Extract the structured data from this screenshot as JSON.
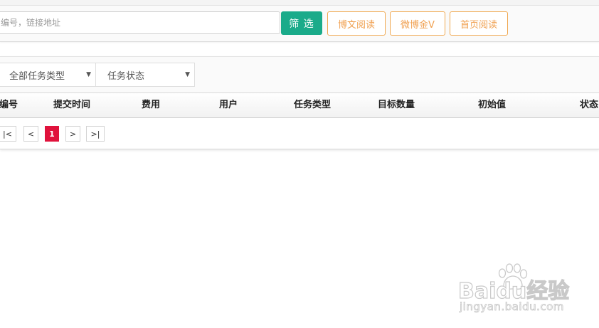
{
  "search": {
    "placeholder": "编号，链接地址",
    "filter_button": "筛 选",
    "quick_links": [
      "博文阅读",
      "微博金V",
      "首页阅读"
    ]
  },
  "filters": {
    "task_type": "全部任务类型",
    "task_status": "任务状态"
  },
  "table": {
    "columns": [
      "编号",
      "提交时间",
      "费用",
      "用户",
      "任务类型",
      "目标数量",
      "初始值",
      "状态"
    ],
    "rows": []
  },
  "pagination": {
    "first": "|<",
    "prev": "<",
    "current_page": "1",
    "next": ">",
    "last": ">|"
  },
  "watermark": {
    "logo": "Baidu经验",
    "url": "jingyan.baidu.com"
  },
  "colors": {
    "primary_button": "#1aab8a",
    "outline_accent": "#f0a850",
    "active_page": "#e0123c"
  }
}
